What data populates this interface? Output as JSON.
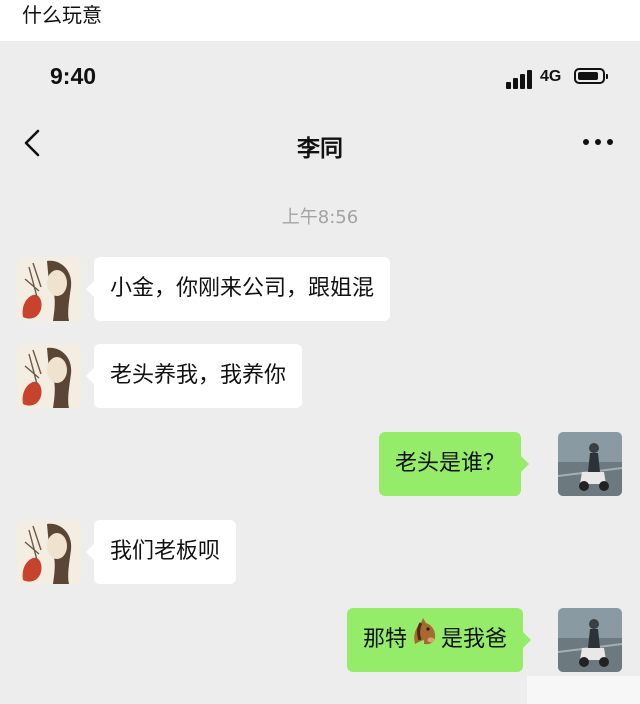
{
  "caption": "什么玩意",
  "status_bar": {
    "time": "9:40",
    "network": "4G"
  },
  "nav": {
    "title": "李同",
    "back_icon": "chevron-left-icon",
    "more_icon": "more-dots-icon"
  },
  "timestamp": "上午8:56",
  "messages": [
    {
      "side": "left",
      "text": "小金，你刚来公司，跟姐混"
    },
    {
      "side": "left",
      "text": "老头养我，我养你"
    },
    {
      "side": "right",
      "text": "老头是谁？"
    },
    {
      "side": "left",
      "text": "我们老板呗"
    },
    {
      "side": "right",
      "text_before": "那特",
      "emoji": "horse-face-emoji",
      "text_after": "是我爸"
    }
  ],
  "colors": {
    "chat_background": "#ededed",
    "sent_bubble": "#95ec69",
    "received_bubble": "#ffffff",
    "timestamp_text": "#a3a3a3"
  }
}
